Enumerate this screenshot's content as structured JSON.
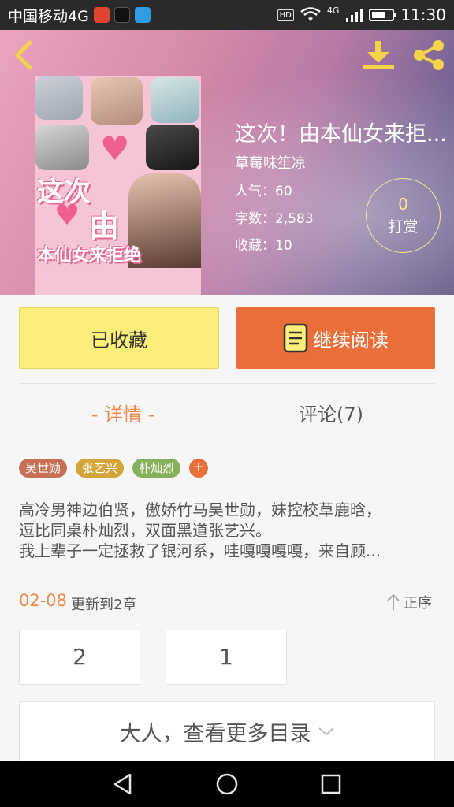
{
  "status_bar": {
    "carrier": "中国移动4G",
    "hd": "HD",
    "network": "4G",
    "time": "11:30"
  },
  "header": {
    "back_icon": "chevron-left-icon",
    "download_icon": "download-icon",
    "share_icon": "share-icon"
  },
  "book": {
    "title": "这次！由本仙女来拒...",
    "author": "草莓味笙凉",
    "popularity_label": "人气：",
    "popularity": "60",
    "words_label": "字数：",
    "words": "2,583",
    "favorites_label": "收藏：",
    "favorites": "10",
    "reward_count": "0",
    "reward_label": "打赏",
    "cover_text_line1": "这次",
    "cover_text_line2": "由",
    "cover_text_line3": "本仙女来拒绝"
  },
  "actions": {
    "collected_label": "已收藏",
    "read_label": "继续阅读"
  },
  "tabs": {
    "detail": "- 详情 -",
    "comments": "评论(7)"
  },
  "tags": [
    {
      "label": "吴世勋",
      "color": "#c76f55"
    },
    {
      "label": "张艺兴",
      "color": "#d2a43a"
    },
    {
      "label": "朴灿烈",
      "color": "#86b05a"
    }
  ],
  "tag_add_label": "+",
  "synopsis": {
    "line1": "高冷男神边伯贤，傲娇竹马吴世勋，妹控校草鹿晗，",
    "line2": "逗比同桌朴灿烈，双面黑道张艺兴。",
    "line3": "我上辈子一定拯救了银河系，哇嘎嘎嘎嘎，来自顾..."
  },
  "update": {
    "date": "02-08",
    "text": "更新到2章",
    "sort_label": "正序"
  },
  "chapters": [
    "2",
    "1"
  ],
  "more_catalog_label": "大人，查看更多目录",
  "colors": {
    "accent_orange": "#e96f3a",
    "collected_yellow": "#fbee7a"
  }
}
